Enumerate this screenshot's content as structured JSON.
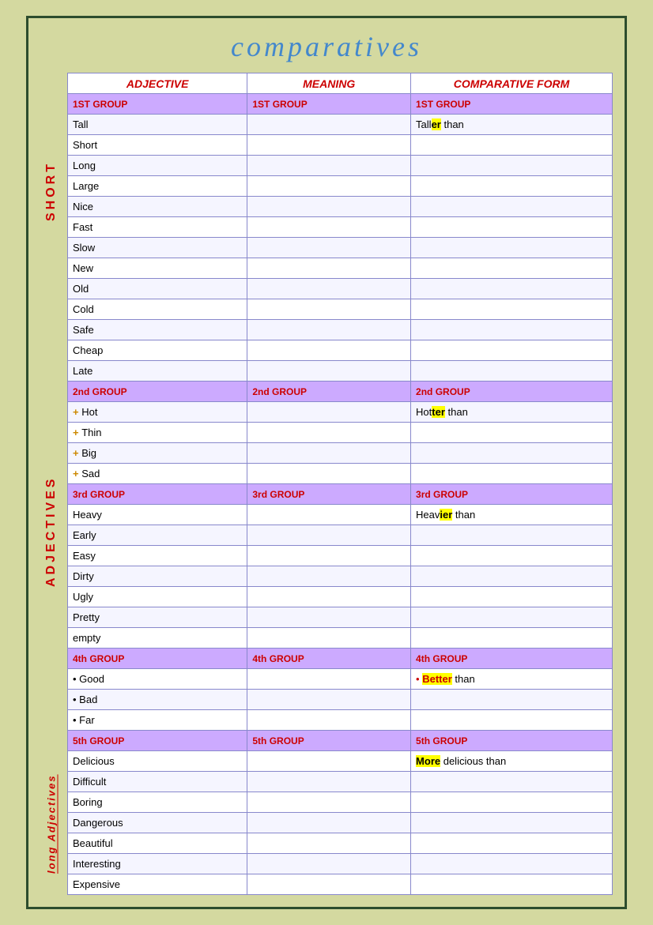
{
  "title": "comparatives",
  "headers": {
    "adjective": "ADJECTIVE",
    "meaning": "MEANING",
    "comparative": "COMPARATIVE FORM"
  },
  "groups": [
    {
      "type": "group",
      "label": "1ST GROUP",
      "meaning": "1ST GROUP",
      "comparative": "1ST GROUP"
    },
    {
      "type": "data",
      "adjective": "Tall",
      "meaning": "",
      "comparative_prefix": "Tall",
      "comparative_highlight": "er",
      "comparative_suffix": "     than"
    },
    {
      "type": "data",
      "adjective": "Short",
      "meaning": "",
      "comparative": ""
    },
    {
      "type": "data",
      "adjective": "Long",
      "meaning": "",
      "comparative": ""
    },
    {
      "type": "data",
      "adjective": "Large",
      "meaning": "",
      "comparative": ""
    },
    {
      "type": "data",
      "adjective": "Nice",
      "meaning": "",
      "comparative": ""
    },
    {
      "type": "data",
      "adjective": "Fast",
      "meaning": "",
      "comparative": ""
    },
    {
      "type": "data",
      "adjective": "Slow",
      "meaning": "",
      "comparative": ""
    },
    {
      "type": "data",
      "adjective": "New",
      "meaning": "",
      "comparative": ""
    },
    {
      "type": "data",
      "adjective": "Old",
      "meaning": "",
      "comparative": ""
    },
    {
      "type": "data",
      "adjective": "Cold",
      "meaning": "",
      "comparative": ""
    },
    {
      "type": "data",
      "adjective": "Safe",
      "meaning": "",
      "comparative": ""
    },
    {
      "type": "data",
      "adjective": "Cheap",
      "meaning": "",
      "comparative": ""
    },
    {
      "type": "data",
      "adjective": "Late",
      "meaning": "",
      "comparative": ""
    },
    {
      "type": "group",
      "label": "2nd  GROUP",
      "meaning": "2nd  GROUP",
      "comparative": "2nd  GROUP"
    },
    {
      "type": "data",
      "adjective": "+ Hot",
      "adjective_plus": true,
      "meaning": "",
      "comparative_prefix": "Hot",
      "comparative_highlight": "ter",
      "comparative_suffix": "     than"
    },
    {
      "type": "data",
      "adjective": "+ Thin",
      "adjective_plus": true,
      "meaning": "",
      "comparative": ""
    },
    {
      "type": "data",
      "adjective": "+ Big",
      "adjective_plus": true,
      "meaning": "",
      "comparative": ""
    },
    {
      "type": "data",
      "adjective": "+ Sad",
      "adjective_plus": true,
      "meaning": "",
      "comparative": ""
    },
    {
      "type": "group",
      "label": "3rd  GROUP",
      "meaning": "3rd  GROUP",
      "comparative": "3rd  GROUP"
    },
    {
      "type": "data",
      "adjective": "Heavy",
      "meaning": "",
      "comparative_prefix": "Heav",
      "comparative_highlight": "ier",
      "comparative_suffix": "     than"
    },
    {
      "type": "data",
      "adjective": "Early",
      "meaning": "",
      "comparative": ""
    },
    {
      "type": "data",
      "adjective": "Easy",
      "meaning": "",
      "comparative": ""
    },
    {
      "type": "data",
      "adjective": "Dirty",
      "meaning": "",
      "comparative": ""
    },
    {
      "type": "data",
      "adjective": "Ugly",
      "meaning": "",
      "comparative": ""
    },
    {
      "type": "data",
      "adjective": "Pretty",
      "meaning": "",
      "comparative": ""
    },
    {
      "type": "data",
      "adjective": "empty",
      "meaning": "",
      "comparative": ""
    },
    {
      "type": "group",
      "label": "4th  GROUP",
      "meaning": "4th  GROUP",
      "comparative": "4th  GROUP"
    },
    {
      "type": "data",
      "adjective": "•  Good",
      "bullet": true,
      "meaning": "",
      "comparative_bullet": true,
      "comparative_prefix": "• ",
      "comparative_highlight_word": "Better",
      "comparative_suffix": "  than"
    },
    {
      "type": "data",
      "adjective": "•  Bad",
      "bullet": true,
      "meaning": "",
      "comparative": ""
    },
    {
      "type": "data",
      "adjective": "•  Far",
      "bullet": true,
      "meaning": "",
      "comparative": ""
    },
    {
      "type": "group",
      "label": "5th  GROUP",
      "meaning": "5th  GROUP",
      "comparative": "5th  GROUP"
    },
    {
      "type": "data",
      "adjective": "Delicious",
      "meaning": "",
      "comparative_more": true,
      "more_text": "More",
      "more_rest": " delicious  than"
    },
    {
      "type": "data",
      "adjective": "Difficult",
      "meaning": "",
      "comparative": ""
    },
    {
      "type": "data",
      "adjective": "Boring",
      "meaning": "",
      "comparative": ""
    },
    {
      "type": "data",
      "adjective": "Dangerous",
      "meaning": "",
      "comparative": ""
    },
    {
      "type": "data",
      "adjective": "Beautiful",
      "meaning": "",
      "comparative": ""
    },
    {
      "type": "data",
      "adjective": "Interesting",
      "meaning": "",
      "comparative": ""
    },
    {
      "type": "data",
      "adjective": "Expensive",
      "meaning": "",
      "comparative": ""
    }
  ],
  "side_labels": {
    "short": "SHORT",
    "adjectives": "ADJECTIVES",
    "long": "long Adjectives"
  }
}
